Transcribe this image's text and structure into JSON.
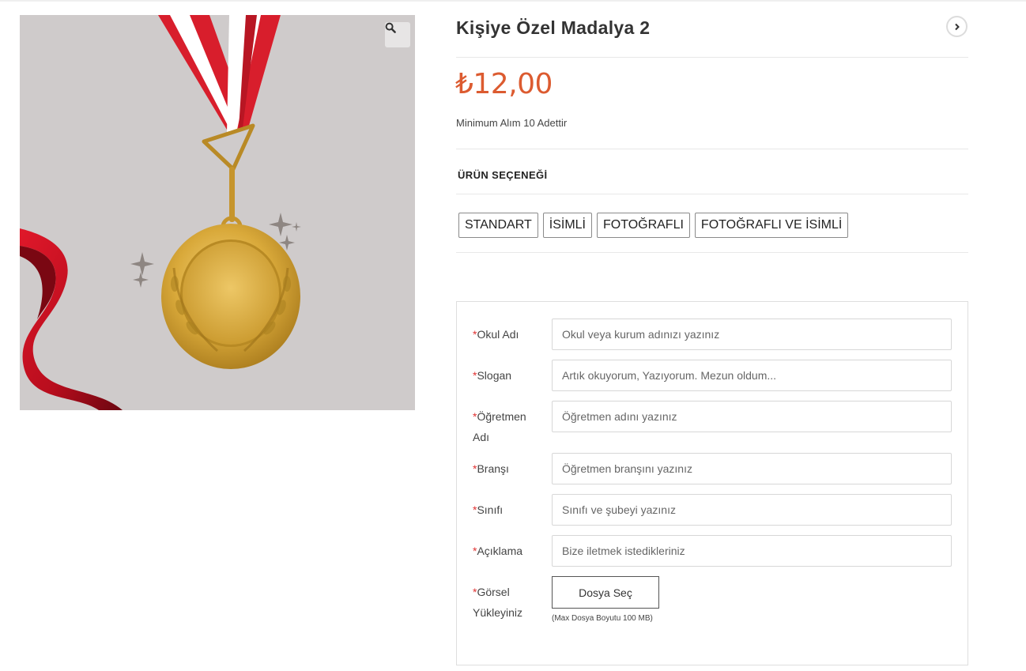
{
  "product": {
    "title": "Kişiye Özel Madalya 2",
    "price": "₺12,00",
    "short_description": "Minimum Alım 10 Adettir"
  },
  "icons": {
    "zoom": "magnifier-icon",
    "next": "chevron-right-icon"
  },
  "colors": {
    "price": "#dc5b30",
    "required": "#e03333",
    "gallery_bg": "#cfcbcb"
  },
  "variations": {
    "label": "ÜRÜN SEÇENEĞİ",
    "options": [
      "STANDART",
      "İSİMLİ",
      "FOTOĞRAFLI",
      "FOTOĞRAFLI VE İSİMLİ"
    ]
  },
  "form": {
    "required_mark": "*",
    "fields": [
      {
        "label": "Okul Adı",
        "placeholder": "Okul veya kurum adınızı yazınız"
      },
      {
        "label": "Slogan",
        "placeholder": "Artık okuyorum, Yazıyorum. Mezun oldum..."
      },
      {
        "label": "Öğretmen Adı",
        "placeholder": "Öğretmen adını yazınız"
      },
      {
        "label": "Branşı",
        "placeholder": "Öğretmen branşını yazınız"
      },
      {
        "label": "Sınıfı",
        "placeholder": "Sınıfı ve şubeyi yazınız"
      },
      {
        "label": "Açıklama",
        "placeholder": "Bize iletmek istedikleriniz"
      }
    ],
    "upload": {
      "label": "Görsel Yükleyiniz",
      "button": "Dosya Seç",
      "hint": "(Max Dosya Boyutu 100 MB)"
    }
  }
}
